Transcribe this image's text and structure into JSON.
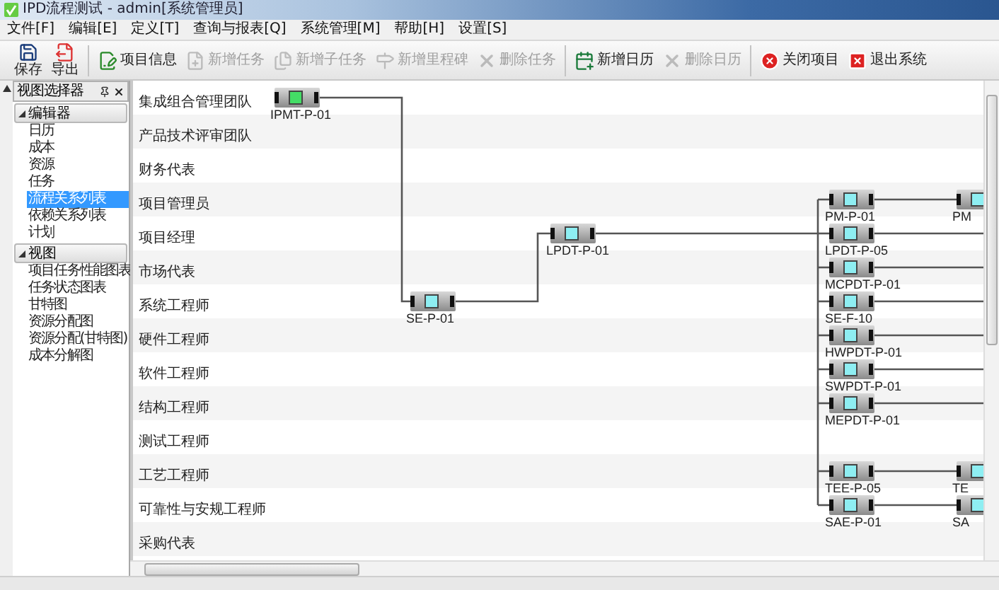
{
  "window": {
    "title": "IPD流程测试 - admin[系统管理员]"
  },
  "menu": [
    "文件[F]",
    "编辑[E]",
    "定义[T]",
    "查询与报表[Q]",
    "系统管理[M]",
    "帮助[H]",
    "设置[S]"
  ],
  "toolbar": [
    {
      "items": [
        {
          "label": "保存",
          "kind": "stacked",
          "disabled": false
        },
        {
          "label": "导出",
          "kind": "stacked",
          "disabled": false
        }
      ]
    },
    {
      "items": [
        {
          "label": "项目信息",
          "kind": "inline",
          "disabled": false
        },
        {
          "label": "新增任务",
          "kind": "inline",
          "disabled": true
        },
        {
          "label": "新增子任务",
          "kind": "inline",
          "disabled": true
        },
        {
          "label": "新增里程碑",
          "kind": "inline",
          "disabled": true
        },
        {
          "label": "删除任务",
          "kind": "inline",
          "disabled": true
        }
      ]
    },
    {
      "items": [
        {
          "label": "新增日历",
          "kind": "inline",
          "disabled": false
        },
        {
          "label": "删除日历",
          "kind": "inline",
          "disabled": true
        }
      ]
    },
    {
      "items": [
        {
          "label": "关闭项目",
          "kind": "inline",
          "disabled": false
        },
        {
          "label": "退出系统",
          "kind": "inline",
          "disabled": false
        }
      ]
    }
  ],
  "view_selector": {
    "title": "视图选择器",
    "groups": [
      {
        "label": "编辑器",
        "expanded": true,
        "children": [
          {
            "label": "日历",
            "selected": false
          },
          {
            "label": "成本",
            "selected": false
          },
          {
            "label": "资源",
            "selected": false
          },
          {
            "label": "任务",
            "selected": false
          },
          {
            "label": "流程关系列表",
            "selected": true
          },
          {
            "label": "依赖关系列表",
            "selected": false
          },
          {
            "label": "计划",
            "selected": false
          }
        ]
      },
      {
        "label": "视图",
        "expanded": true,
        "children": [
          {
            "label": "项目任务性能图表",
            "selected": false
          },
          {
            "label": "任务状态图表",
            "selected": false
          },
          {
            "label": "甘特图",
            "selected": false
          },
          {
            "label": "资源分配图",
            "selected": false
          },
          {
            "label": "资源分配(甘特图)",
            "selected": false
          },
          {
            "label": "成本分解图",
            "selected": false
          }
        ]
      }
    ]
  },
  "lanes": [
    {
      "label": "集成组合管理团队",
      "tasks": [
        {
          "label": "IPMT-P-01",
          "color": "#44dd66"
        }
      ]
    },
    {
      "label": "产品技术评审团队"
    },
    {
      "label": "财务代表"
    },
    {
      "label": "项目管理员",
      "tasks": [
        {
          "label": "PM-P-01",
          "color": "#8eeef2"
        },
        {
          "label": "PM",
          "color": "#8eeef2"
        }
      ]
    },
    {
      "label": "项目经理",
      "tasks": [
        {
          "label": "LPDT-P-01",
          "color": "#8eeef2"
        },
        {
          "label": "LPDT-P-05",
          "color": "#8eeef2"
        }
      ]
    },
    {
      "label": "市场代表",
      "tasks": [
        {
          "label": "MCPDT-P-01",
          "color": "#8eeef2"
        }
      ]
    },
    {
      "label": "系统工程师",
      "tasks": [
        {
          "label": "SE-P-01",
          "color": "#8eeef2"
        },
        {
          "label": "SE-F-10",
          "color": "#8eeef2"
        }
      ]
    },
    {
      "label": "硬件工程师",
      "tasks": [
        {
          "label": "HWPDT-P-01",
          "color": "#8eeef2"
        }
      ]
    },
    {
      "label": "软件工程师",
      "tasks": [
        {
          "label": "SWPDT-P-01",
          "color": "#8eeef2"
        }
      ]
    },
    {
      "label": "结构工程师",
      "tasks": [
        {
          "label": "MEPDT-P-01",
          "color": "#8eeef2"
        }
      ]
    },
    {
      "label": "测试工程师"
    },
    {
      "label": "工艺工程师",
      "tasks": [
        {
          "label": "TEE-P-05",
          "color": "#8eeef2"
        },
        {
          "label": "TE",
          "color": "#8eeef2"
        }
      ]
    },
    {
      "label": "可靠性与安规工程师",
      "tasks": [
        {
          "label": "SAE-P-01",
          "color": "#8eeef2"
        },
        {
          "label": "SA",
          "color": "#8eeef2"
        }
      ]
    },
    {
      "label": "采购代表"
    }
  ]
}
